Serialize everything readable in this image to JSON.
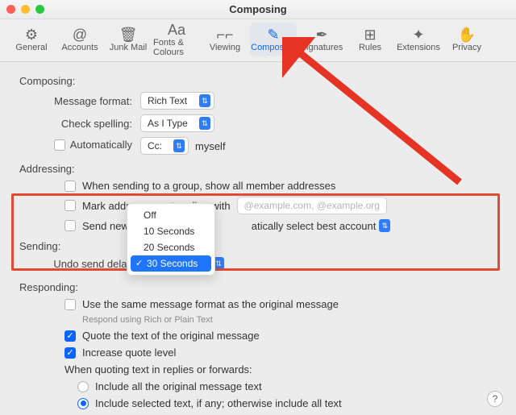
{
  "window": {
    "title": "Composing"
  },
  "toolbar": {
    "items": [
      {
        "label": "General",
        "icon": "⚙",
        "active": false
      },
      {
        "label": "Accounts",
        "icon": "@",
        "active": false
      },
      {
        "label": "Junk Mail",
        "icon": "🗑",
        "active": false
      },
      {
        "label": "Fonts & Colours",
        "icon": "Aa",
        "active": false
      },
      {
        "label": "Viewing",
        "icon": "⌐⌐",
        "active": false
      },
      {
        "label": "Composing",
        "icon": "✎",
        "active": true
      },
      {
        "label": "Signatures",
        "icon": "✒",
        "active": false
      },
      {
        "label": "Rules",
        "icon": "⊞",
        "active": false
      },
      {
        "label": "Extensions",
        "icon": "✦",
        "active": false
      },
      {
        "label": "Privacy",
        "icon": "✋",
        "active": false
      }
    ]
  },
  "sections": {
    "composing": {
      "heading": "Composing:",
      "message_format_label": "Message format:",
      "message_format_value": "Rich Text",
      "check_spelling_label": "Check spelling:",
      "check_spelling_value": "As I Type",
      "auto_cc_label": "Automatically",
      "auto_cc_select": "Cc:",
      "auto_cc_suffix": "myself"
    },
    "addressing": {
      "heading": "Addressing:",
      "group_label": "When sending to a group, show all member addresses",
      "mark_label": "Mark addresses not ending with",
      "mark_placeholder": "@example.com, @example.org",
      "send_from_prefix": "Send new messa",
      "send_from_suffix": "atically select best account"
    },
    "sending": {
      "heading": "Sending:",
      "undo_label": "Undo send delay",
      "options": [
        "Off",
        "10 Seconds",
        "20 Seconds",
        "30 Seconds"
      ],
      "selected": "30 Seconds"
    },
    "responding": {
      "heading": "Responding:",
      "same_format_label": "Use the same message format as the original message",
      "same_format_hint": "Respond using Rich or Plain Text",
      "quote_label": "Quote the text of the original message",
      "increase_label": "Increase quote level",
      "when_quoting_label": "When quoting text in replies or forwards:",
      "include_all_label": "Include all the original message text",
      "include_selected_label": "Include selected text, if any; otherwise include all text"
    }
  },
  "help_label": "?"
}
